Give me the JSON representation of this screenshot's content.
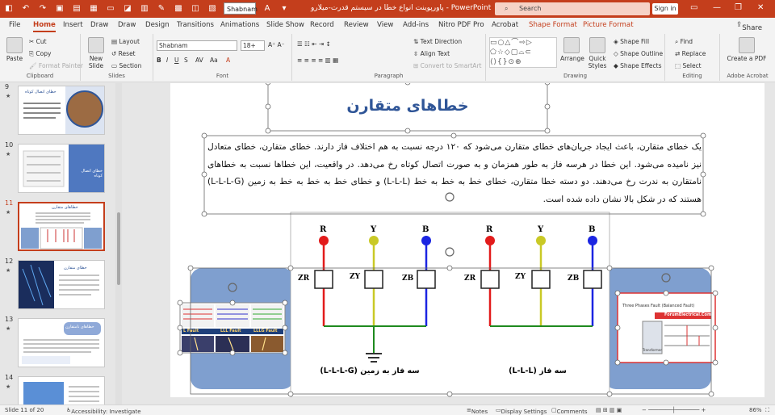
{
  "titlebar": {
    "title": "پاورپوینت انواع خطا در سیستم قدرت-میلارو  -  PowerPoint",
    "font_value": "Shabnam",
    "search_placeholder": "Search",
    "signin": "Sign in",
    "color": "#c43e1c"
  },
  "tabs": [
    "File",
    "Home",
    "Insert",
    "Draw",
    "Draw",
    "Design",
    "Transitions",
    "Animations",
    "Slide Show",
    "Record",
    "Review",
    "View",
    "Add-ins",
    "Nitro PDF Pro",
    "Acrobat",
    "Shape Format",
    "Picture Format"
  ],
  "share": "Share",
  "ribbon": {
    "clipboard": {
      "label": "Clipboard",
      "paste": "Paste",
      "cut": "Cut",
      "copy": "Copy",
      "format_painter": "Format Painter"
    },
    "slides": {
      "label": "Slides",
      "new_slide": "New Slide",
      "layout": "Layout",
      "reset": "Reset",
      "section": "Section"
    },
    "font": {
      "label": "Font",
      "font_name": "Shabnam",
      "font_size": "18+"
    },
    "paragraph": {
      "label": "Paragraph",
      "text_direction": "Text Direction",
      "align_text": "Align Text",
      "smartart": "Convert to SmartArt"
    },
    "drawing": {
      "label": "Drawing",
      "arrange": "Arrange",
      "quick_styles": "Quick Styles",
      "shape_fill": "Shape Fill",
      "shape_outline": "Shape Outline",
      "shape_effects": "Shape Effects"
    },
    "editing": {
      "label": "Editing",
      "find": "Find",
      "replace": "Replace",
      "select": "Select"
    },
    "acrobat": {
      "label": "Adobe Acrobat",
      "create_pdf": "Create a PDF"
    }
  },
  "thumbnails": [
    {
      "num": "9",
      "title": "خطای اتصال کوتاه"
    },
    {
      "num": "10",
      "title": "خطای اتصال کوتاه"
    },
    {
      "num": "11",
      "title": "خطاهای متقارن"
    },
    {
      "num": "12",
      "title": "خطای متقارن"
    },
    {
      "num": "13",
      "title": "خطاهای نامتقارن"
    },
    {
      "num": "14",
      "title": ""
    }
  ],
  "slide": {
    "title": "خطاهای متقارن",
    "body": "یک خطای متقارن، باعث ایجاد جریان‌های خطای متقارن می‌شود که ۱۲۰ درجه نسبت به هم اختلاف فاز دارند. خطای متقارن، خطای متعادل نیز نامیده می‌شود. این خطا در هرسه فاز به طور همزمان و به صورت اتصال کوتاه رخ می‌دهد. در واقعیت، این خطاها نسبت به خطاهای نامتقارن به ندرت رخ می‌دهند. دو دسته خطا متقارن، خطای خط به خط به خط (L-L-L) و خطای خط به خط به خط به زمین (L-L-L-G) هستند که در شکل بالا نشان داده شده است.",
    "phase_r": "R",
    "phase_y": "Y",
    "phase_b": "B",
    "z_r": "ZR",
    "z_y": "ZY",
    "z_b": "ZB",
    "caption_left": "سه فاز به زمین (L-L-L-G)",
    "caption_right": "سه فاز (L-L-L)",
    "left_img_labels": [
      "L Fault",
      "LLL Fault",
      "LLLG Fault"
    ],
    "right_img_title": "Three Phases Fault (Balanced Fault)",
    "right_img_brand": "ForumElectrical.Com",
    "right_img_inner": "Transformer",
    "colors": {
      "red": "#e21b1b",
      "yellow": "#c9c926",
      "blue": "#1b25e2",
      "green": "#1e8a1e",
      "title": "#2f5597",
      "panel": "#7f9fcf"
    }
  },
  "status": {
    "slide": "Slide 11 of 20",
    "accessibility": "Accessibility: Investigate",
    "notes": "Notes",
    "display": "Display Settings",
    "comments": "Comments",
    "zoom": "86%"
  }
}
